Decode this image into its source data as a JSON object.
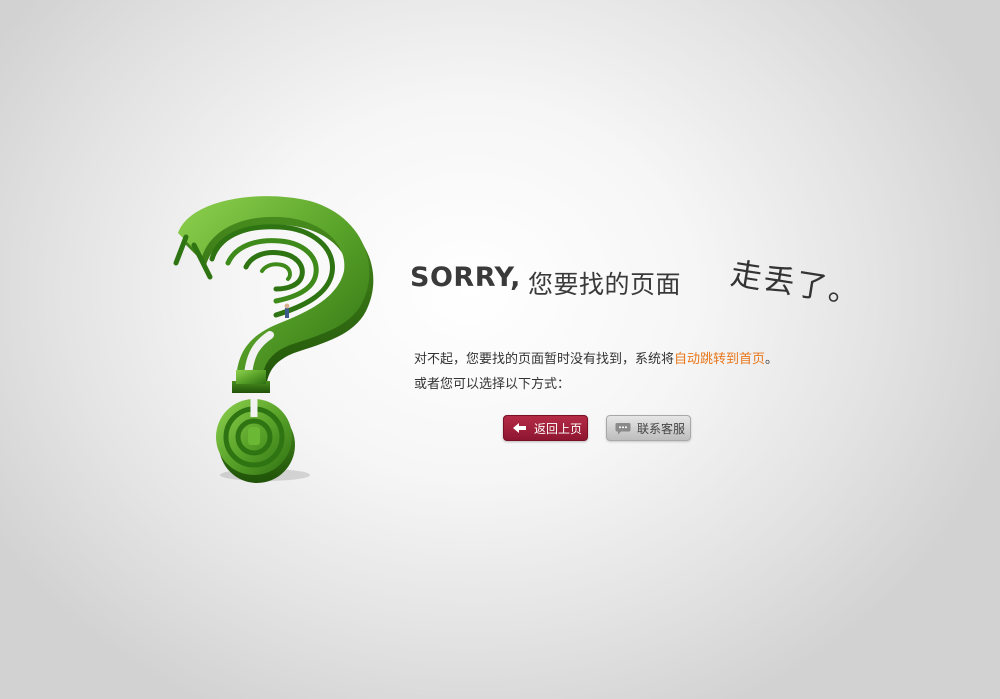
{
  "headline": {
    "sorry": "SORRY,",
    "rest": "您要找的页面",
    "lost": "走丢了。"
  },
  "message": {
    "line1_prefix": "对不起，您要找的页面暂时没有找到，系统将",
    "line1_highlight": "自动跳转到首页",
    "line1_suffix": "。",
    "line2": "或者您可以选择以下方式："
  },
  "buttons": {
    "back_label": "返回上页",
    "back_icon": "arrow-left-icon",
    "service_label": "联系客服",
    "service_icon": "chat-bubble-icon"
  },
  "colors": {
    "highlight": "#e8761a",
    "back_button": "#a21f3b",
    "service_button": "#d0d0d0",
    "maze_green": "#5aa42a"
  }
}
